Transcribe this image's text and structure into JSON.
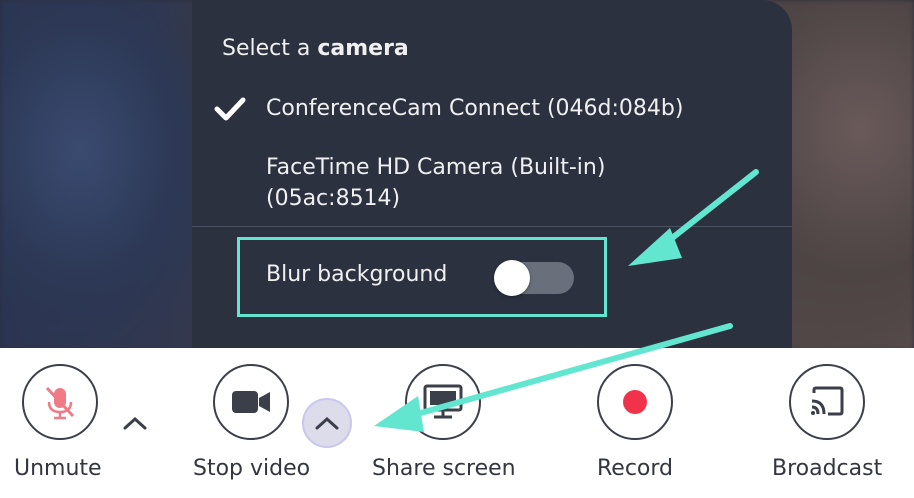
{
  "menu": {
    "title_prefix": "Select a ",
    "title_bold": "camera",
    "options": [
      {
        "label": "ConferenceCam Connect (046d:084b)",
        "selected": true
      },
      {
        "label": "FaceTime HD Camera (Built-in) (05ac:8514)",
        "selected": false
      }
    ],
    "blur_label": "Blur background",
    "blur_enabled": false
  },
  "toolbar": {
    "buttons": [
      {
        "label": "Unmute",
        "icon": "mic-muted-icon"
      },
      {
        "label": "Stop video",
        "icon": "video-camera-icon"
      },
      {
        "label": "Share screen",
        "icon": "monitor-icon"
      },
      {
        "label": "Record",
        "icon": "record-icon"
      },
      {
        "label": "Broadcast",
        "icon": "cast-icon"
      }
    ]
  },
  "colors": {
    "accent_highlight": "#63e6cf",
    "record_red": "#f0334a",
    "muted_red": "#f07a85",
    "menu_bg": "#2c3140"
  }
}
